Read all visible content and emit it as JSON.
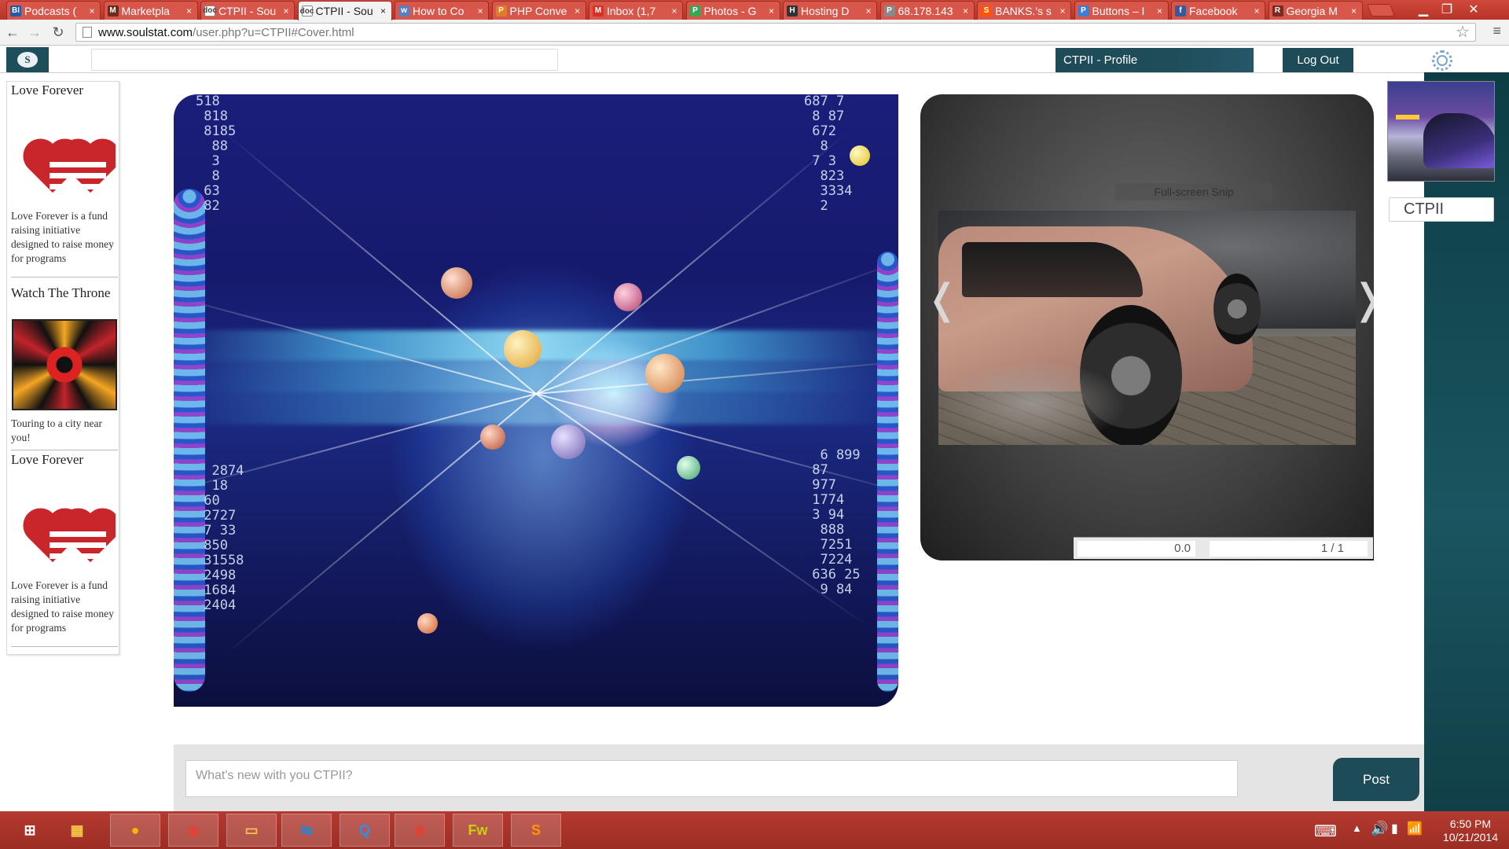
{
  "browser": {
    "tabs": [
      {
        "title": "Podcasts (",
        "favicon": "BI",
        "color": "#1d5aa8",
        "active": false
      },
      {
        "title": "Marketpla",
        "favicon": "M",
        "color": "#6b2a1a",
        "active": false
      },
      {
        "title": "CTPII - Sou",
        "favicon": "doc",
        "color": "#ffffff",
        "active": false
      },
      {
        "title": "CTPII - Sou",
        "favicon": "doc",
        "color": "#ffffff",
        "active": true
      },
      {
        "title": "How to Co",
        "favicon": "w",
        "color": "#5a7fc0",
        "active": false
      },
      {
        "title": "PHP Conve",
        "favicon": "P",
        "color": "#e07b2a",
        "active": false
      },
      {
        "title": "Inbox (1,7",
        "favicon": "M",
        "color": "#d93025",
        "active": false
      },
      {
        "title": "Photos - G",
        "favicon": "P",
        "color": "#34a853",
        "active": false
      },
      {
        "title": "Hosting D",
        "favicon": "H",
        "color": "#333333",
        "active": false
      },
      {
        "title": "68.178.143",
        "favicon": "P",
        "color": "#888888",
        "active": false
      },
      {
        "title": "BANKS.'s s",
        "favicon": "S",
        "color": "#ff5500",
        "active": false
      },
      {
        "title": "Buttons – I",
        "favicon": "P",
        "color": "#3b7dd8",
        "active": false
      },
      {
        "title": "Facebook",
        "favicon": "f",
        "color": "#3b5998",
        "active": false
      },
      {
        "title": "Georgia M",
        "favicon": "R",
        "color": "#7a2a20",
        "active": false
      }
    ],
    "url_host": "www.soulstat.com",
    "url_path": "/user.php?u=CTPII#Cover.html"
  },
  "header": {
    "logo_text": "S",
    "profile_label": "CTPII - Profile",
    "logout_label": "Log Out"
  },
  "sidebar": {
    "blocks": [
      {
        "title": "Love Forever",
        "desc": "Love Forever is a fund raising initiative designed to raise money for programs",
        "image": "hearts"
      },
      {
        "title": "Watch The Throne",
        "desc": "Touring to a city near you!",
        "image": "kaleidoscope"
      },
      {
        "title": "Love Forever",
        "desc": "Love Forever is a fund raising initiative designed to raise money for programs",
        "image": "hearts"
      }
    ]
  },
  "slider": {
    "snip_label": "Full-screen Snip",
    "prev_glyph": "❬",
    "next_glyph": "❭",
    "rating": "0.0",
    "count": "1 / 1"
  },
  "profile": {
    "name": "CTPII"
  },
  "composer": {
    "placeholder": "What's new with you CTPII?",
    "post_label": "Post"
  },
  "taskbar": {
    "apps": [
      {
        "name": "start-icon",
        "glyph": "⊞",
        "color": "#ffffff"
      },
      {
        "name": "apps-icon",
        "glyph": "▦",
        "color": "#f7c948"
      },
      {
        "name": "yellow-circle-app-icon",
        "glyph": "●",
        "color": "#f5b700"
      },
      {
        "name": "chrome-icon",
        "glyph": "◉",
        "color": "#db4437"
      },
      {
        "name": "file-explorer-icon",
        "glyph": "▭",
        "color": "#f3c64b"
      },
      {
        "name": "teamviewer-icon",
        "glyph": "⇆",
        "color": "#0e8ee9"
      },
      {
        "name": "quicktime-icon",
        "glyph": "Q",
        "color": "#2a8ff2"
      },
      {
        "name": "chrome-icon-2",
        "glyph": "◉",
        "color": "#db4437"
      },
      {
        "name": "fireworks-icon",
        "glyph": "Fw",
        "color": "#c8d400"
      },
      {
        "name": "sublime-icon",
        "glyph": "S",
        "color": "#ff9800"
      }
    ],
    "time": "6:50 PM",
    "date": "10/21/2014"
  },
  "colors": {
    "accent": "#1d4b57",
    "taskbar": "#b43a30",
    "tabstrip": "#cf4a3c"
  }
}
